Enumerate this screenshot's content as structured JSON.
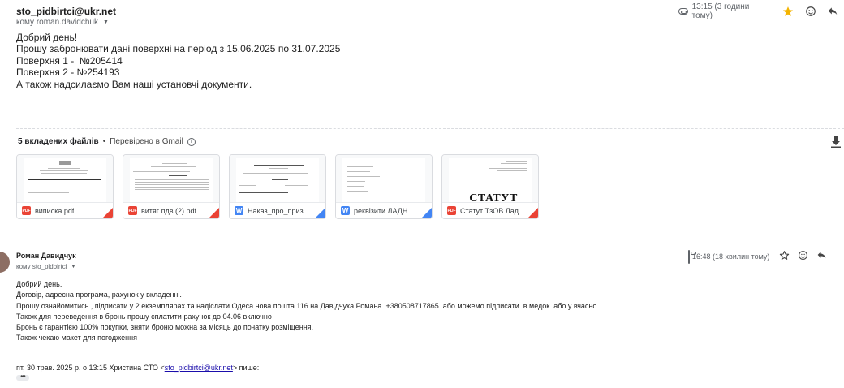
{
  "message1": {
    "sender": "sto_pidbirtci@ukr.net",
    "recipient": "кому roman.davidchuk",
    "time": "13:15 (3 години тому)",
    "starred": true,
    "star_color": "#f4b400",
    "body": [
      "Добрий день!",
      "Прошу забронювати дані поверхні на період з 15.06.2025 по 31.07.2025",
      "",
      "Поверхня 1 -  №205414",
      "Поверхня 2 - №254193",
      "",
      "А також надсилаємо Вам наші установчі документи."
    ],
    "attachments_header": {
      "count": "5 вкладених файлів",
      "bullet": "•",
      "checked": "Перевірено в Gmail"
    },
    "attachments": [
      {
        "name": "виписка.pdf",
        "type": "pdf",
        "badge": "PDF"
      },
      {
        "name": "витяг пдв (2).pdf",
        "type": "pdf",
        "badge": "PDF"
      },
      {
        "name": "Наказ_про_приз…",
        "type": "doc",
        "badge": "W"
      },
      {
        "name": "реквізити ЛАДН…",
        "type": "doc",
        "badge": "W"
      },
      {
        "name": "Статут ТзОВ Лад…",
        "type": "pdf",
        "badge": "PDF",
        "thumb_text": "СТАТУТ"
      }
    ]
  },
  "message2": {
    "sender": "Роман Давидчук",
    "recipient": "кому sto_pidbirtci",
    "time": "16:48 (18 хвилин тому)",
    "starred": false,
    "body": [
      "Добрий день.",
      "Договір, адресна програма, рахунок у вкладенні.",
      "Прошу ознайомитись , підписати у 2 екземплярах та надіслати Одеса нова пошта 116 на Давідчука Романа. +380508717865  або можемо підписати  в медок  або у вчасно.",
      "Також для переведення в бронь прошу сплатити рахунок до 04.06 включно",
      "Бронь є гарантією 100% покупки, зняти броню можна за місяць до початку розміщення.",
      "",
      "Також чекаю макет для погодження"
    ],
    "quote_prefix": "пт, 30 трав. 2025 р. о 13:15 Христина СТО <",
    "quote_email": "sto_pidbirtci@ukr.net",
    "quote_suffix": "> пише:",
    "dots": "•••"
  }
}
